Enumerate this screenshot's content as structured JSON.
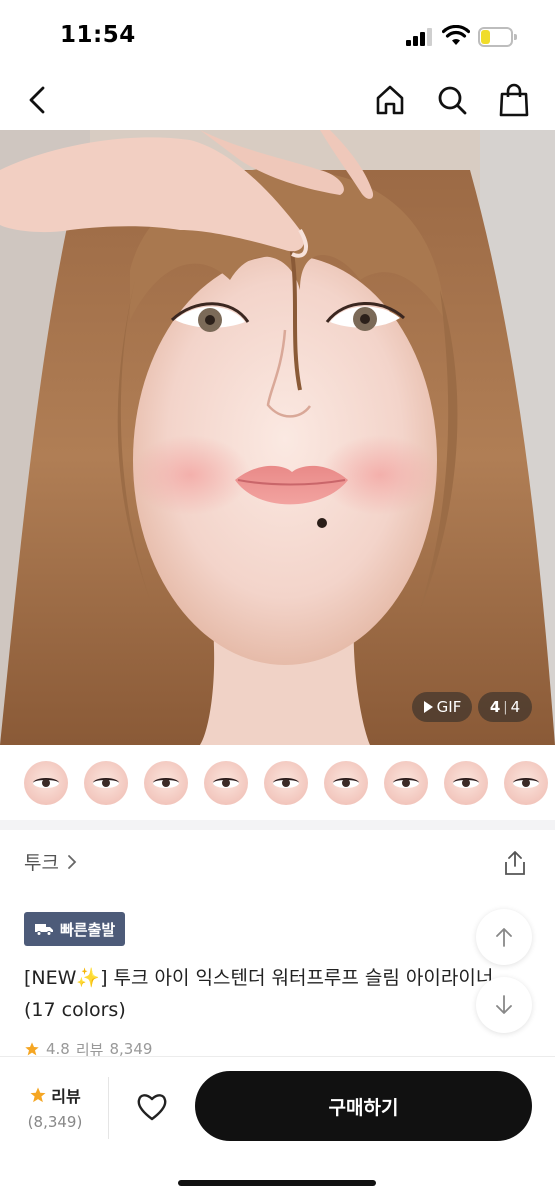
{
  "status_bar": {
    "time": "11:54"
  },
  "nav": {
    "back_icon": "chevron-left-icon",
    "home_icon": "home-icon",
    "search_icon": "search-icon",
    "bag_icon": "shopping-bag-icon"
  },
  "gallery": {
    "gif_label": "GIF",
    "current": "4",
    "separator": "|",
    "total": "4",
    "swatch_count": 9
  },
  "product": {
    "brand": "투크",
    "badge": "빠른출발",
    "title": "[NEW✨] 투크 아이 익스텐더 워터프루프 슬림 아이라이너 (17 colors)",
    "rating": "4.8",
    "review_label": "리뷰",
    "review_count": "8,349"
  },
  "bottom_bar": {
    "review_label": "리뷰",
    "review_count": "(8,349)",
    "buy_label": "구매하기"
  },
  "colors": {
    "badge_bg": "#4d5b79",
    "star": "#f5a623",
    "buy_bg": "#111111"
  }
}
